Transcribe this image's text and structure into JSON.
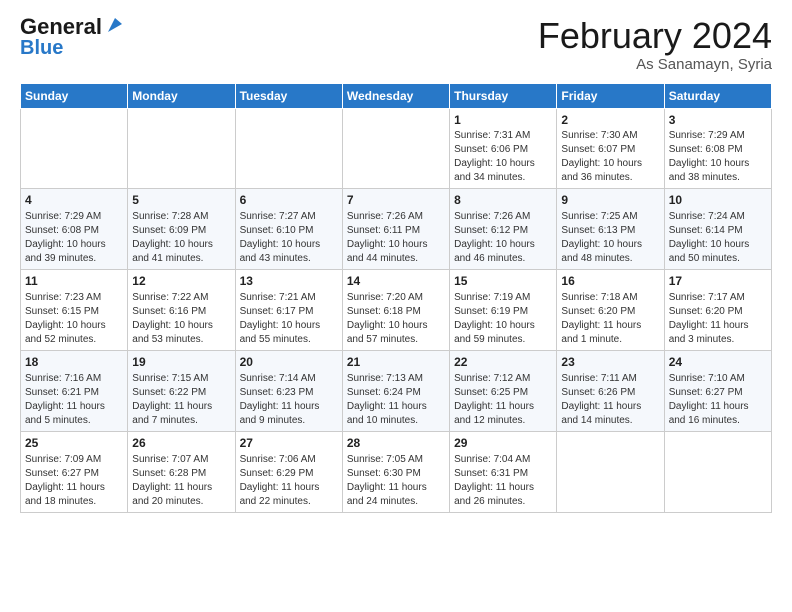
{
  "logo": {
    "line1": "General",
    "line2": "Blue"
  },
  "title": "February 2024",
  "subtitle": "As Sanamayn, Syria",
  "days_of_week": [
    "Sunday",
    "Monday",
    "Tuesday",
    "Wednesday",
    "Thursday",
    "Friday",
    "Saturday"
  ],
  "weeks": [
    [
      {
        "day": "",
        "info": ""
      },
      {
        "day": "",
        "info": ""
      },
      {
        "day": "",
        "info": ""
      },
      {
        "day": "",
        "info": ""
      },
      {
        "day": "1",
        "info": "Sunrise: 7:31 AM\nSunset: 6:06 PM\nDaylight: 10 hours and 34 minutes."
      },
      {
        "day": "2",
        "info": "Sunrise: 7:30 AM\nSunset: 6:07 PM\nDaylight: 10 hours and 36 minutes."
      },
      {
        "day": "3",
        "info": "Sunrise: 7:29 AM\nSunset: 6:08 PM\nDaylight: 10 hours and 38 minutes."
      }
    ],
    [
      {
        "day": "4",
        "info": "Sunrise: 7:29 AM\nSunset: 6:08 PM\nDaylight: 10 hours and 39 minutes."
      },
      {
        "day": "5",
        "info": "Sunrise: 7:28 AM\nSunset: 6:09 PM\nDaylight: 10 hours and 41 minutes."
      },
      {
        "day": "6",
        "info": "Sunrise: 7:27 AM\nSunset: 6:10 PM\nDaylight: 10 hours and 43 minutes."
      },
      {
        "day": "7",
        "info": "Sunrise: 7:26 AM\nSunset: 6:11 PM\nDaylight: 10 hours and 44 minutes."
      },
      {
        "day": "8",
        "info": "Sunrise: 7:26 AM\nSunset: 6:12 PM\nDaylight: 10 hours and 46 minutes."
      },
      {
        "day": "9",
        "info": "Sunrise: 7:25 AM\nSunset: 6:13 PM\nDaylight: 10 hours and 48 minutes."
      },
      {
        "day": "10",
        "info": "Sunrise: 7:24 AM\nSunset: 6:14 PM\nDaylight: 10 hours and 50 minutes."
      }
    ],
    [
      {
        "day": "11",
        "info": "Sunrise: 7:23 AM\nSunset: 6:15 PM\nDaylight: 10 hours and 52 minutes."
      },
      {
        "day": "12",
        "info": "Sunrise: 7:22 AM\nSunset: 6:16 PM\nDaylight: 10 hours and 53 minutes."
      },
      {
        "day": "13",
        "info": "Sunrise: 7:21 AM\nSunset: 6:17 PM\nDaylight: 10 hours and 55 minutes."
      },
      {
        "day": "14",
        "info": "Sunrise: 7:20 AM\nSunset: 6:18 PM\nDaylight: 10 hours and 57 minutes."
      },
      {
        "day": "15",
        "info": "Sunrise: 7:19 AM\nSunset: 6:19 PM\nDaylight: 10 hours and 59 minutes."
      },
      {
        "day": "16",
        "info": "Sunrise: 7:18 AM\nSunset: 6:20 PM\nDaylight: 11 hours and 1 minute."
      },
      {
        "day": "17",
        "info": "Sunrise: 7:17 AM\nSunset: 6:20 PM\nDaylight: 11 hours and 3 minutes."
      }
    ],
    [
      {
        "day": "18",
        "info": "Sunrise: 7:16 AM\nSunset: 6:21 PM\nDaylight: 11 hours and 5 minutes."
      },
      {
        "day": "19",
        "info": "Sunrise: 7:15 AM\nSunset: 6:22 PM\nDaylight: 11 hours and 7 minutes."
      },
      {
        "day": "20",
        "info": "Sunrise: 7:14 AM\nSunset: 6:23 PM\nDaylight: 11 hours and 9 minutes."
      },
      {
        "day": "21",
        "info": "Sunrise: 7:13 AM\nSunset: 6:24 PM\nDaylight: 11 hours and 10 minutes."
      },
      {
        "day": "22",
        "info": "Sunrise: 7:12 AM\nSunset: 6:25 PM\nDaylight: 11 hours and 12 minutes."
      },
      {
        "day": "23",
        "info": "Sunrise: 7:11 AM\nSunset: 6:26 PM\nDaylight: 11 hours and 14 minutes."
      },
      {
        "day": "24",
        "info": "Sunrise: 7:10 AM\nSunset: 6:27 PM\nDaylight: 11 hours and 16 minutes."
      }
    ],
    [
      {
        "day": "25",
        "info": "Sunrise: 7:09 AM\nSunset: 6:27 PM\nDaylight: 11 hours and 18 minutes."
      },
      {
        "day": "26",
        "info": "Sunrise: 7:07 AM\nSunset: 6:28 PM\nDaylight: 11 hours and 20 minutes."
      },
      {
        "day": "27",
        "info": "Sunrise: 7:06 AM\nSunset: 6:29 PM\nDaylight: 11 hours and 22 minutes."
      },
      {
        "day": "28",
        "info": "Sunrise: 7:05 AM\nSunset: 6:30 PM\nDaylight: 11 hours and 24 minutes."
      },
      {
        "day": "29",
        "info": "Sunrise: 7:04 AM\nSunset: 6:31 PM\nDaylight: 11 hours and 26 minutes."
      },
      {
        "day": "",
        "info": ""
      },
      {
        "day": "",
        "info": ""
      }
    ]
  ]
}
